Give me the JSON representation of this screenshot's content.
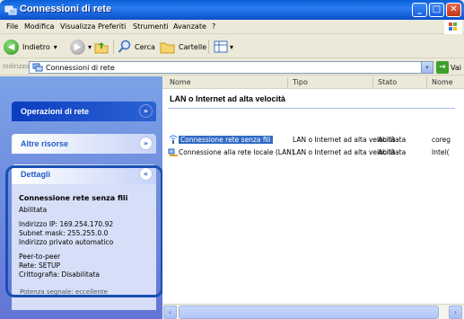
{
  "window": {
    "title": "Connessioni di rete",
    "controls": {
      "minimize": "_",
      "maximize": "□",
      "close": "✕"
    }
  },
  "menubar": {
    "items": [
      "File",
      "Modifica",
      "Visualizza",
      "Preferiti",
      "Strumenti",
      "Avanzate",
      "?"
    ]
  },
  "toolbar": {
    "back_label": "Indietro",
    "search_label": "Cerca",
    "folders_label": "Cartelle"
  },
  "address": {
    "label": "Indirizzo",
    "value": "Connessioni di rete",
    "go_label": "Vai"
  },
  "taskpane": {
    "network_tasks_title": "Operazioni di rete",
    "other_places_title": "Altre risorse",
    "details_title": "Dettagli",
    "details": {
      "name": "Connessione rete senza fili",
      "status": "Abilitata",
      "ip": "Indirizzo IP: 169.254.170.92",
      "subnet": "Subnet mask: 255.255.0.0",
      "private": "Indirizzo privato automatico",
      "mode": "Peer-to-peer",
      "network": "Rete: SETUP",
      "encryption": "Crittografia: Disabilitata"
    },
    "faded_text": "Potenza segnale: eccellente"
  },
  "columns": [
    "Nome",
    "Tipo",
    "Stato",
    "Nome"
  ],
  "group_title": "LAN o Internet ad alta velocità",
  "rows": [
    {
      "name": "Connessione rete senza fili",
      "type": "LAN o Internet ad alta velocità",
      "status": "Abilitata",
      "device": "coreg"
    },
    {
      "name": "Connessione alla rete locale (LAN)",
      "type": "LAN o Internet ad alta velocità",
      "status": "Abilitata",
      "device": "Intel("
    }
  ],
  "colors": {
    "titlebar": "#0a5fd8",
    "taskpane": "#7ba2e7",
    "selection": "#316ac5",
    "highlight_border": "#1a4fb4"
  }
}
